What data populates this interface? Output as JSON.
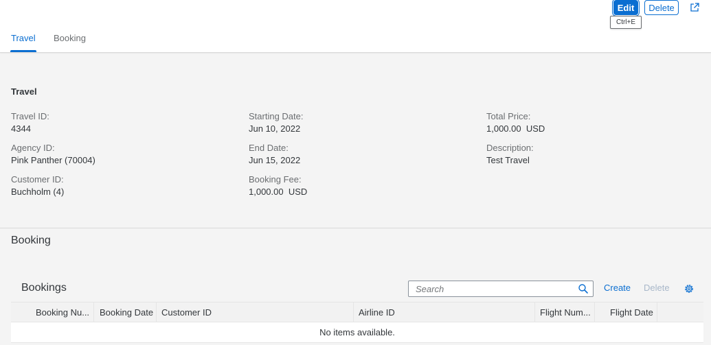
{
  "header": {
    "edit_label": "Edit",
    "delete_label": "Delete",
    "edit_tooltip": "Ctrl+E",
    "tabs": [
      {
        "label": "Travel",
        "active": true
      },
      {
        "label": "Booking",
        "active": false
      }
    ]
  },
  "travel": {
    "title": "Travel",
    "fields": {
      "travel_id": {
        "label": "Travel ID:",
        "value": "4344"
      },
      "agency_id": {
        "label": "Agency ID:",
        "value": "Pink Panther (70004)"
      },
      "customer_id": {
        "label": "Customer ID:",
        "value": "Buchholm (4)"
      },
      "starting_date": {
        "label": "Starting Date:",
        "value": "Jun 10, 2022"
      },
      "end_date": {
        "label": "End Date:",
        "value": "Jun 15, 2022"
      },
      "booking_fee": {
        "label": "Booking Fee:",
        "value": "1,000.00  USD"
      },
      "total_price": {
        "label": "Total Price:",
        "value": "1,000.00  USD"
      },
      "description": {
        "label": "Description:",
        "value": "Test Travel"
      }
    }
  },
  "booking": {
    "heading": "Booking",
    "table": {
      "title": "Bookings",
      "search_placeholder": "Search",
      "create_label": "Create",
      "delete_label": "Delete",
      "columns": [
        "Booking Nu...",
        "Booking Date",
        "Customer ID",
        "Airline ID",
        "Flight Num...",
        "Flight Date"
      ],
      "empty_text": "No items available."
    }
  },
  "colors": {
    "accent": "#0a6ed1",
    "disabled_link": "#a8b7c9",
    "background": "#f4f4f4"
  }
}
